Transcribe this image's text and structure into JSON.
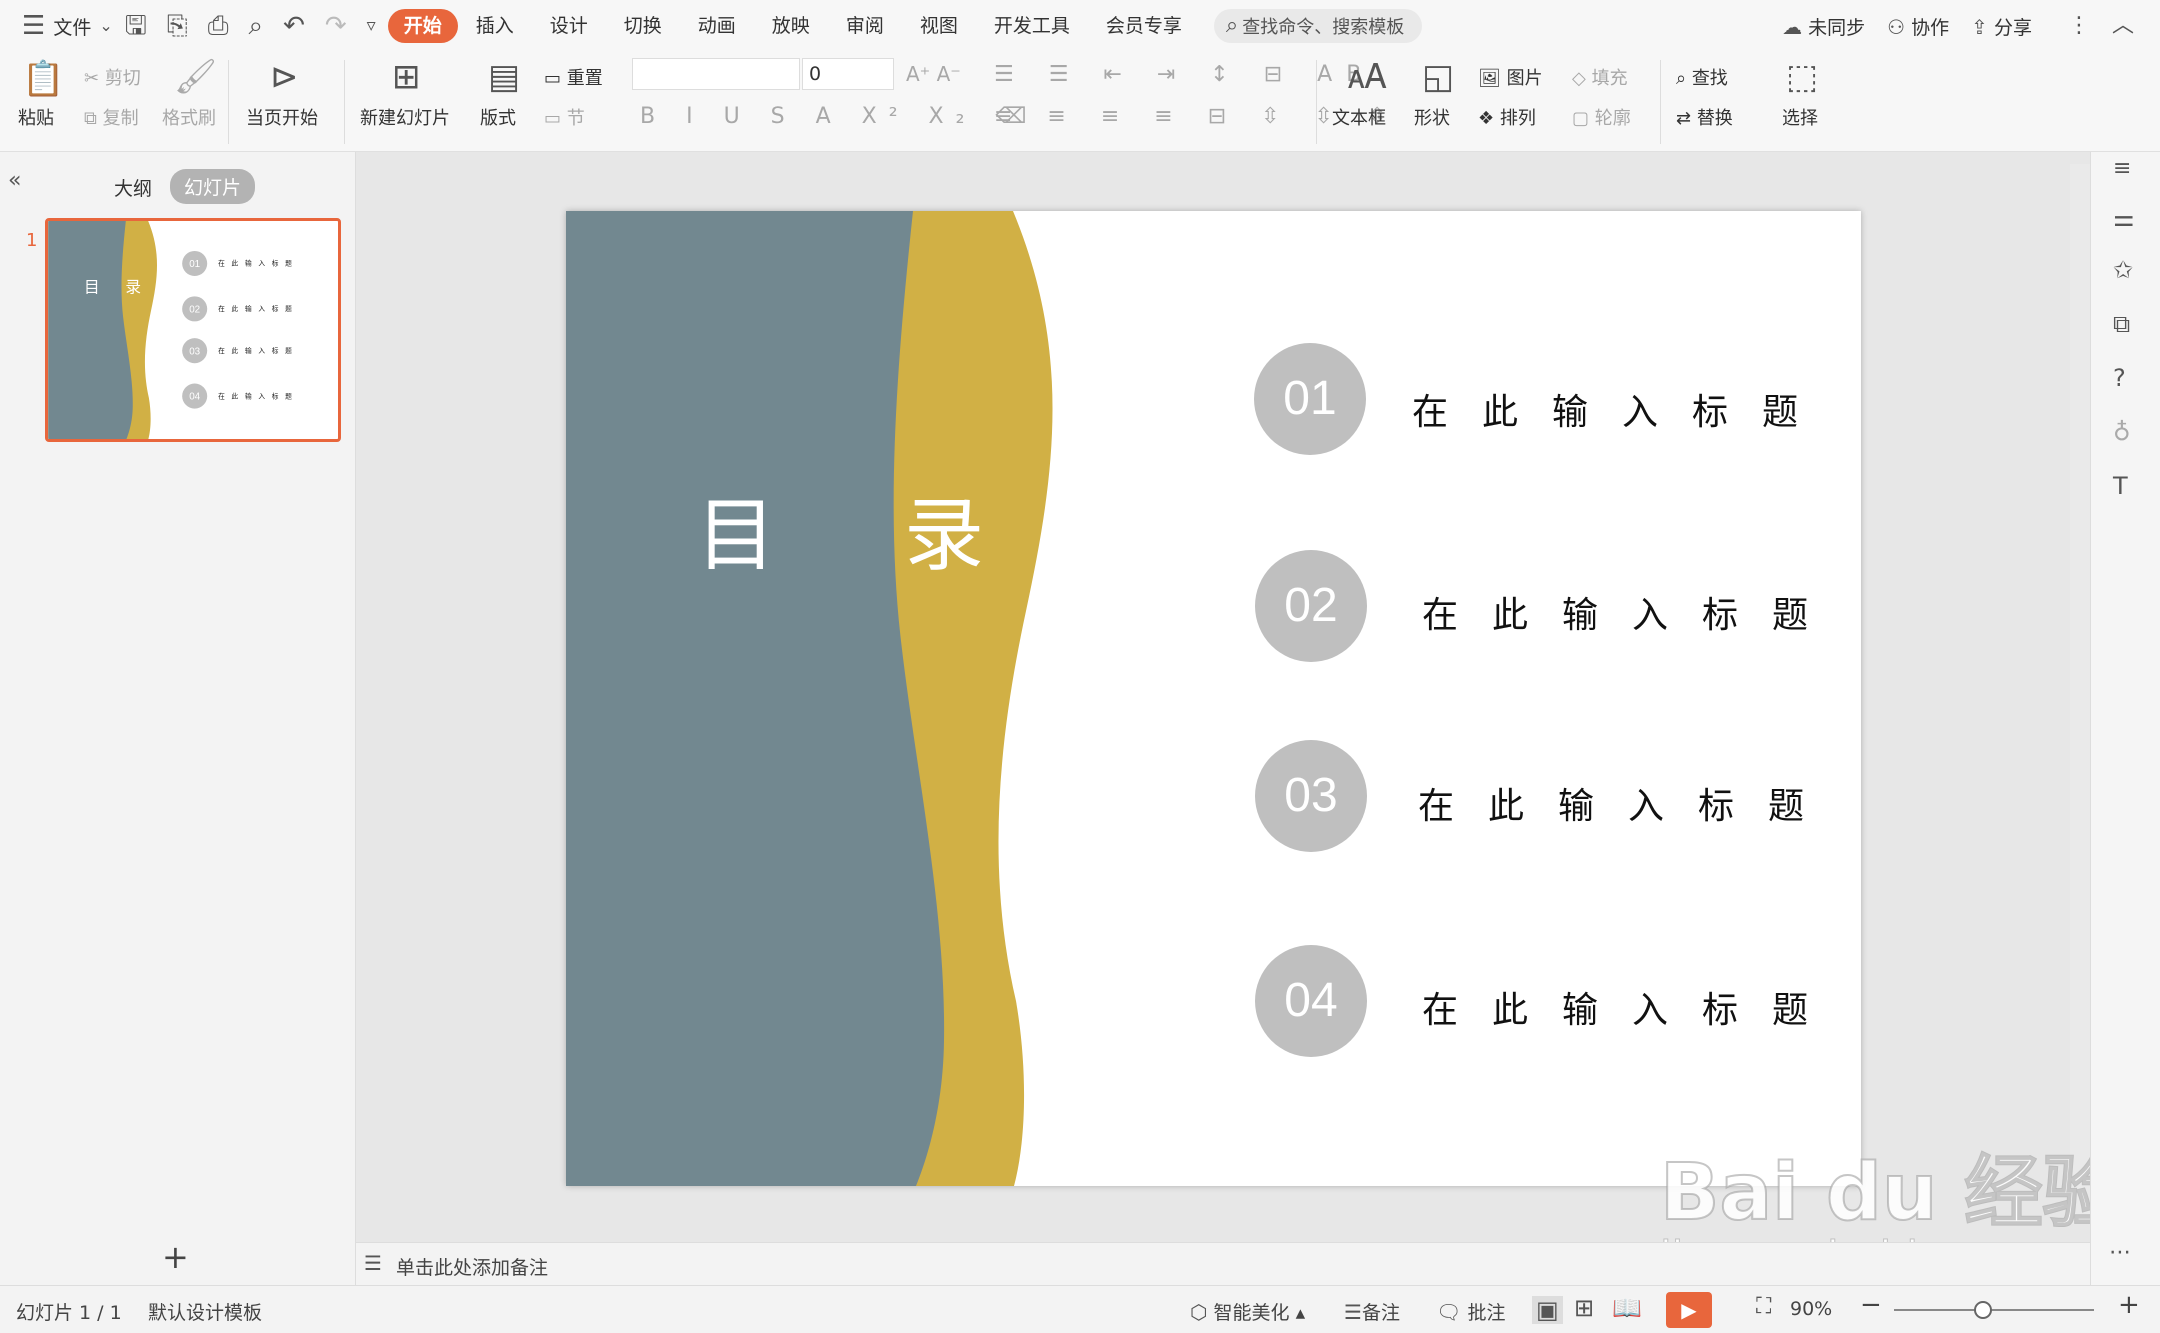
{
  "menu": {
    "file_label": "文件",
    "tabs": [
      "开始",
      "插入",
      "设计",
      "切换",
      "动画",
      "放映",
      "审阅",
      "视图",
      "开发工具",
      "会员专享"
    ],
    "search_placeholder": "查找命令、搜索模板",
    "unsynced": "未同步",
    "collab": "协作",
    "share": "分享"
  },
  "ribbon": {
    "paste": "粘贴",
    "cut": "剪切",
    "copy": "复制",
    "format_painter": "格式刷",
    "play_current": "当页开始",
    "new_slide": "新建幻灯片",
    "layout": "版式",
    "reset": "重置",
    "section": "节",
    "font_size": "0",
    "textbox": "文本框",
    "shape": "形状",
    "picture": "图片",
    "fill": "填充",
    "arrange": "排列",
    "outline": "轮廓",
    "find": "查找",
    "replace": "替换",
    "select": "选择"
  },
  "panel": {
    "tab_outline": "大纲",
    "tab_slides": "幻灯片",
    "slide_number": "1"
  },
  "slide": {
    "title_char1": "目",
    "title_char2": "录",
    "items": [
      {
        "num": "01",
        "title": "在此输入标题"
      },
      {
        "num": "02",
        "title": "在此输入标题"
      },
      {
        "num": "03",
        "title": "在此输入标题"
      },
      {
        "num": "04",
        "title": "在此输入标题"
      }
    ],
    "colors": {
      "gray": "#728890",
      "gold": "#d1b045",
      "circle": "#bfbfbf"
    }
  },
  "notes_placeholder": "单击此处添加备注",
  "status": {
    "slide_count": "幻灯片 1 / 1",
    "template": "默认设计模板",
    "beautify": "智能美化",
    "notes": "备注",
    "comments": "批注",
    "zoom": "90%"
  },
  "watermark": {
    "brand": "Bai du 经验",
    "url": "jingyan.baidu.com"
  }
}
